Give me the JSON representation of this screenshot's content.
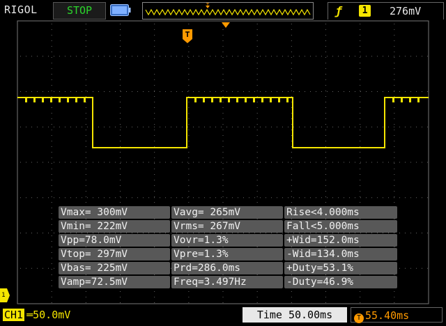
{
  "header": {
    "brand": "RIGOL",
    "run_state": "STOP",
    "trigger_edge_icon": "rising-edge-icon",
    "trigger_source": "1",
    "trigger_level": "276mV"
  },
  "waveform": {
    "trigger_marker": "T",
    "channel_color": "#f5e600"
  },
  "measurements": [
    [
      "Vmax= 300mV",
      "Vavg= 265mV",
      "Rise<4.000ms"
    ],
    [
      "Vmin= 222mV",
      "Vrms= 267mV",
      "Fall<5.000ms"
    ],
    [
      "Vpp=78.0mV",
      "Vovr=1.3%",
      "+Wid=152.0ms"
    ],
    [
      "Vtop= 297mV",
      "Vpre=1.3%",
      "-Wid=134.0ms"
    ],
    [
      "Vbas= 225mV",
      "Prd=286.0ms",
      "+Duty=53.1%"
    ],
    [
      "Vamp=72.5mV",
      "Freq=3.497Hz",
      "-Duty=46.9%"
    ]
  ],
  "footer": {
    "channel_label": "CH1",
    "coupling_icon": "dc-coupling-icon",
    "volts_div": "50.0mV",
    "timebase": "Time 50.00ms",
    "trigger_offset": "55.40ms",
    "offset_marker": "T"
  }
}
